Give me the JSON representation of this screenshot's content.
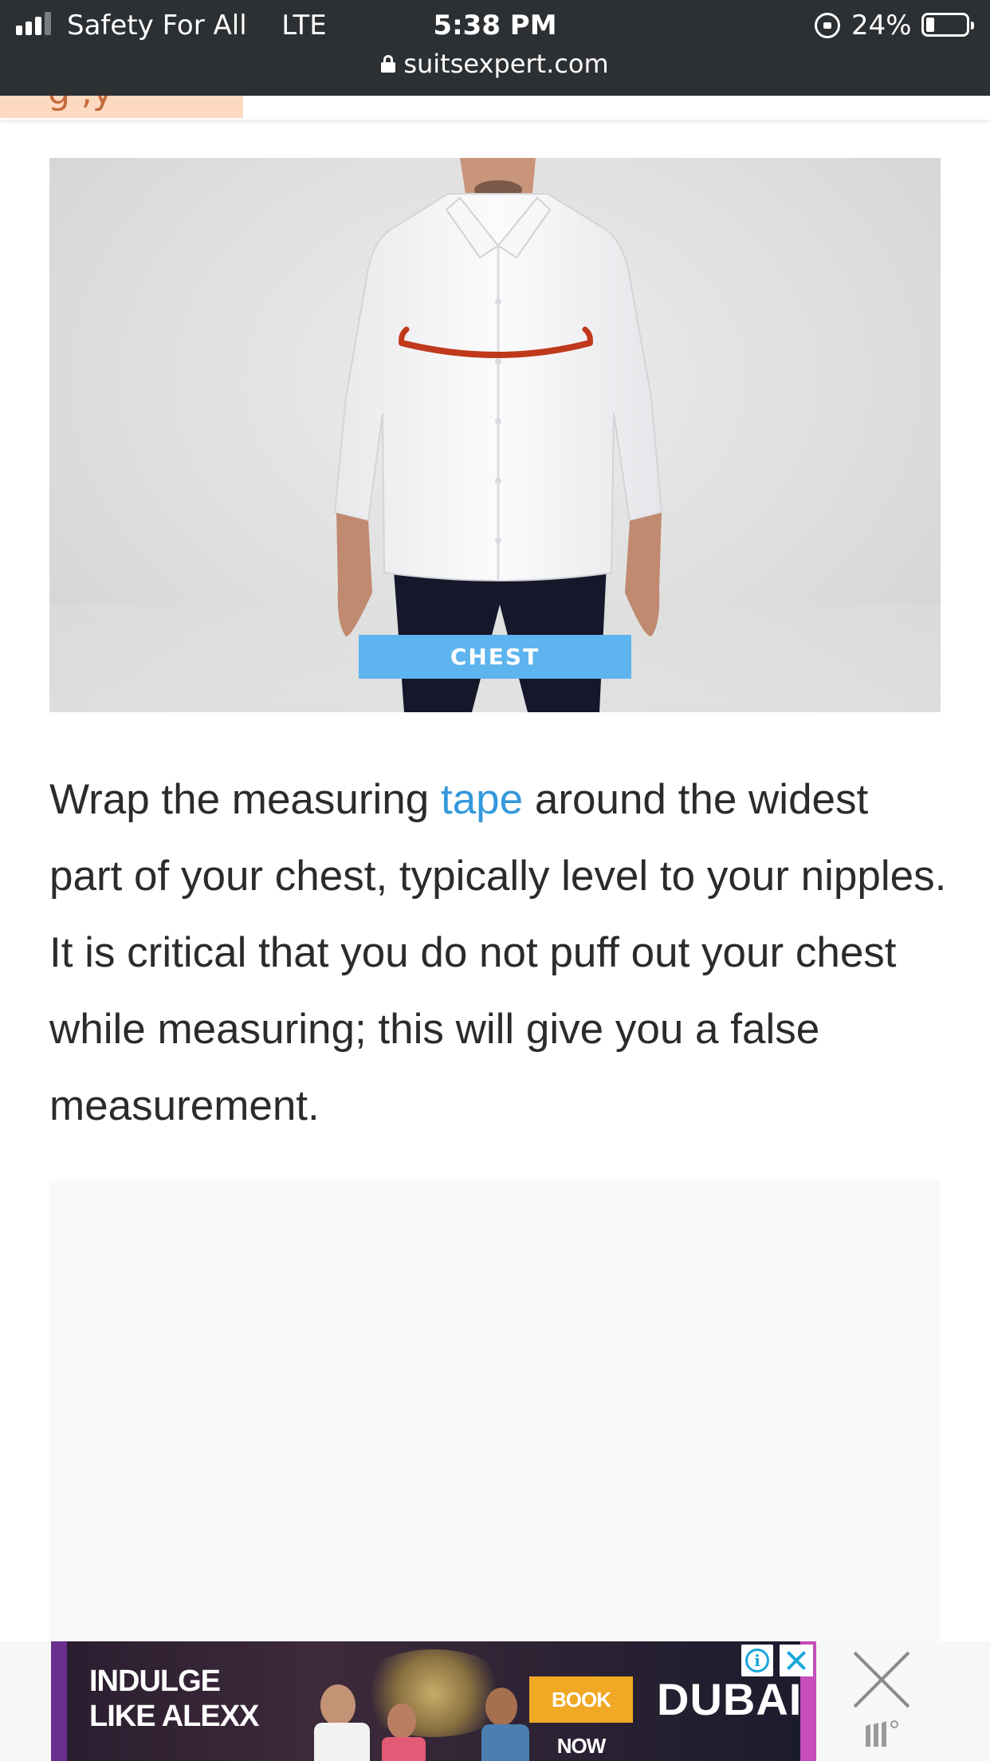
{
  "status_bar": {
    "carrier": "Safety For All",
    "network": "LTE",
    "time": "5:38 PM",
    "battery_percent": "24%",
    "battery_level": 0.24,
    "url": "suitsexpert.com"
  },
  "hero": {
    "label": "CHEST"
  },
  "article": {
    "text_before_link": "Wrap the measuring ",
    "link_text": "tape",
    "text_after_link": " around the widest part of your chest, typically level to your nipples. It is critical that you do not puff out your chest while measuring; this will give you a false measurement."
  },
  "ad": {
    "headline": "INDULGE LIKE ALEXX",
    "cta": "BOOK NOW",
    "brand": "DUBAI",
    "adchoices_glyph": "i"
  },
  "colors": {
    "status_bar_bg": "#2d3033",
    "link": "#3498db",
    "chest_label_bg": "#5db4ee",
    "tape_line": "#c0391b",
    "nav_tab_bg": "#fdd9bf"
  }
}
